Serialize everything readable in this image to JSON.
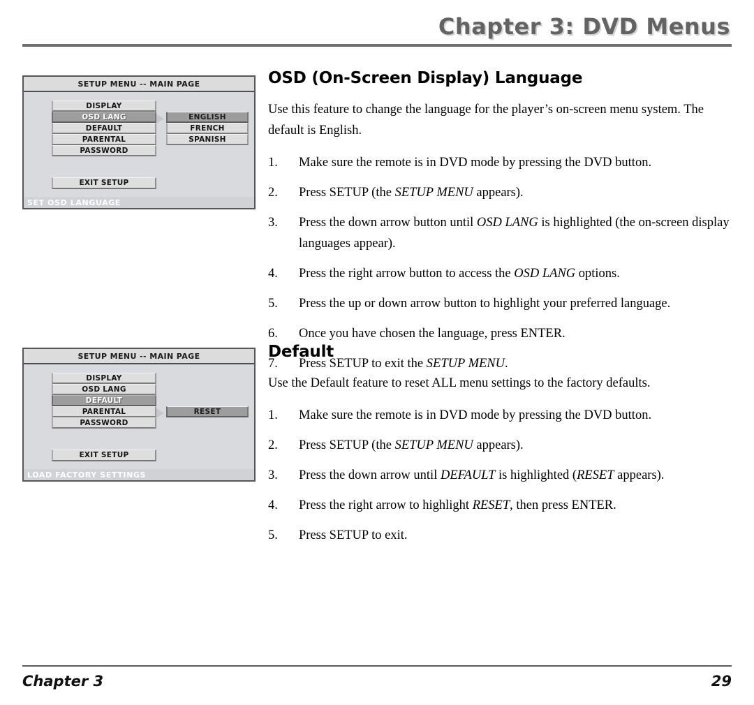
{
  "header": {
    "chapter_title": "Chapter 3: DVD Menus"
  },
  "footer": {
    "chapter_label": "Chapter 3",
    "page_number": "29"
  },
  "osd_menu_1": {
    "titlebar": "SETUP MENU -- MAIN PAGE",
    "items": [
      {
        "label": "DISPLAY",
        "highlighted": false
      },
      {
        "label": "OSD LANG",
        "highlighted": true
      },
      {
        "label": "DEFAULT",
        "highlighted": false
      },
      {
        "label": "PARENTAL",
        "highlighted": false
      },
      {
        "label": "PASSWORD",
        "highlighted": false
      }
    ],
    "options": [
      {
        "label": "ENGLISH",
        "highlighted": true
      },
      {
        "label": "FRENCH",
        "highlighted": false
      },
      {
        "label": "SPANISH",
        "highlighted": false
      }
    ],
    "exit_label": "EXIT SETUP",
    "status": "SET OSD LANGUAGE"
  },
  "osd_menu_2": {
    "titlebar": "SETUP MENU -- MAIN PAGE",
    "items": [
      {
        "label": "DISPLAY",
        "highlighted": false
      },
      {
        "label": "OSD LANG",
        "highlighted": false
      },
      {
        "label": "DEFAULT",
        "highlighted": true
      },
      {
        "label": "PARENTAL",
        "highlighted": false
      },
      {
        "label": "PASSWORD",
        "highlighted": false
      }
    ],
    "options": [
      {
        "label": "RESET",
        "highlighted": true
      }
    ],
    "exit_label": "EXIT SETUP",
    "status": "LOAD FACTORY SETTINGS"
  },
  "section_osd": {
    "heading": "OSD (On-Screen Display) Language",
    "intro": "Use this feature to change the language for the player’s on-screen menu system. The default is English.",
    "steps": [
      {
        "num": "1.",
        "html": "Make sure the remote is in DVD mode by pressing the DVD button."
      },
      {
        "num": "2.",
        "html": "Press SETUP (the <em>SETUP MENU</em> appears)."
      },
      {
        "num": "3.",
        "html": "Press the down arrow button until <em>OSD LANG</em> is highlighted (the on-screen display languages appear)."
      },
      {
        "num": "4.",
        "html": "Press the right arrow button to access the <em>OSD LANG</em> options."
      },
      {
        "num": "5.",
        "html": "Press the up or down arrow button to highlight your preferred language."
      },
      {
        "num": "6.",
        "html": "Once you have chosen the language, press ENTER."
      },
      {
        "num": "7.",
        "html": "Press SETUP to exit the <em>SETUP MENU</em>."
      }
    ]
  },
  "section_default": {
    "heading": "Default",
    "intro": "Use the Default feature to reset ALL menu settings to the factory defaults.",
    "steps": [
      {
        "num": "1.",
        "html": "Make sure the remote is in DVD mode by pressing the DVD button."
      },
      {
        "num": "2.",
        "html": "Press SETUP (the <em>SETUP MENU</em> appears)."
      },
      {
        "num": "3.",
        "html": "Press the down arrow until <em>DEFAULT</em> is highlighted (<em>RESET</em> appears)."
      },
      {
        "num": "4.",
        "html": "Press the right arrow to highlight <em>RESET</em>, then press ENTER."
      },
      {
        "num": "5.",
        "html": "Press SETUP to exit."
      }
    ]
  },
  "colors": {
    "osd_panel_bg": "#d8dadd",
    "osd_titlebar_bg": "#dcdcdc",
    "osd_button_bg": "#dedede",
    "osd_highlight_bg": "#9d9d9d",
    "header_title": "#636363",
    "header_shadow": "#d2d2d2",
    "rule": "#6e6e6e"
  }
}
